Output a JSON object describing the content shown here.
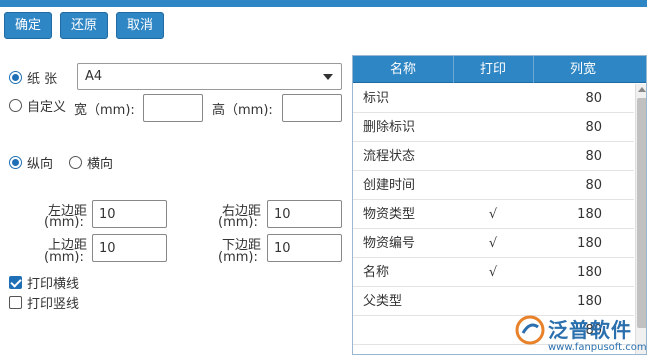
{
  "toolbar": {
    "ok_label": "确定",
    "restore_label": "还原",
    "cancel_label": "取消"
  },
  "paper": {
    "paper_label": "纸 张",
    "paper_value": "A4",
    "custom_label": "自定义",
    "width_label": "宽（mm):",
    "height_label": "高（mm):",
    "width_value": "",
    "height_value": ""
  },
  "orientation": {
    "portrait_label": "纵向",
    "landscape_label": "横向",
    "selected": "portrait"
  },
  "margins": {
    "left_label_1": "左边距",
    "left_label_2": "(mm):",
    "right_label_1": "右边距",
    "right_label_2": "(mm):",
    "top_label_1": "上边距",
    "top_label_2": "(mm):",
    "bottom_label_1": "下边距",
    "bottom_label_2": "(mm):",
    "left_value": "10",
    "right_value": "10",
    "top_value": "10",
    "bottom_value": "10"
  },
  "options": {
    "print_hlines_label": "打印横线",
    "print_hlines": true,
    "print_vlines_label": "打印竖线",
    "print_vlines": false
  },
  "grid": {
    "headers": [
      "名称",
      "打印",
      "列宽"
    ],
    "rows": [
      {
        "name": "标识",
        "print": "",
        "width": "80"
      },
      {
        "name": "删除标识",
        "print": "",
        "width": "80"
      },
      {
        "name": "流程状态",
        "print": "",
        "width": "80"
      },
      {
        "name": "创建时间",
        "print": "",
        "width": "80"
      },
      {
        "name": "物资类型",
        "print": "√",
        "width": "180"
      },
      {
        "name": "物资编号",
        "print": "√",
        "width": "180"
      },
      {
        "name": "名称",
        "print": "√",
        "width": "180"
      },
      {
        "name": "父类型",
        "print": "",
        "width": "180"
      },
      {
        "name": "",
        "print": "",
        "width": "80"
      }
    ]
  },
  "watermark": {
    "brand": "泛普软件",
    "url": "www.fanpusoft.com"
  },
  "colors": {
    "accent": "#2f86c4",
    "check": "#1e6fb5"
  }
}
